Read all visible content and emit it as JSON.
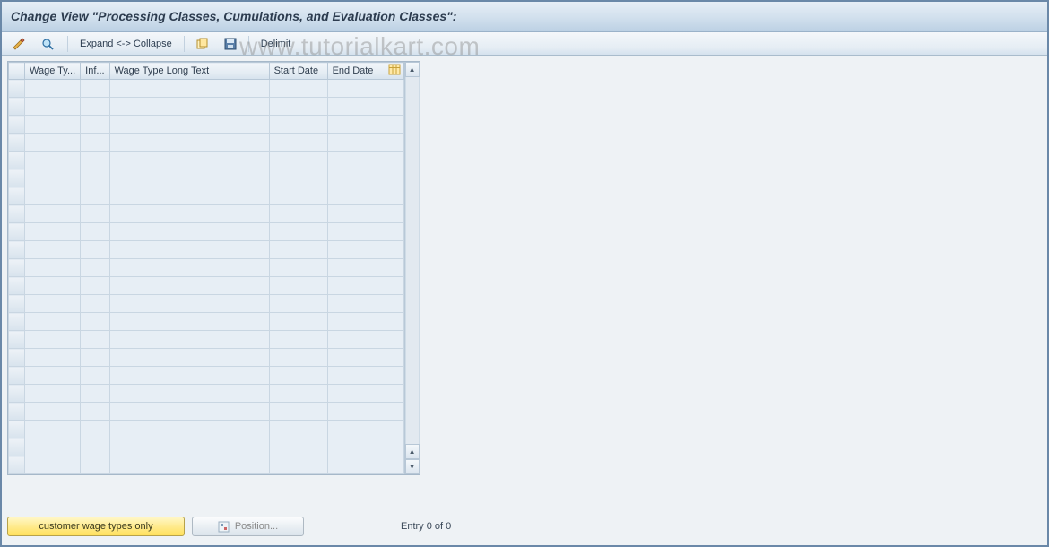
{
  "title": "Change View \"Processing Classes, Cumulations, and Evaluation Classes\":",
  "toolbar": {
    "expand_collapse": "Expand <-> Collapse",
    "delimit": "Delimit"
  },
  "columns": {
    "wage_type": "Wage Ty...",
    "inf": "Inf...",
    "long_text": "Wage Type Long Text",
    "start_date": "Start Date",
    "end_date": "End Date"
  },
  "rows": [
    {},
    {},
    {},
    {},
    {},
    {},
    {},
    {},
    {},
    {},
    {},
    {},
    {},
    {},
    {},
    {},
    {},
    {},
    {},
    {},
    {},
    {}
  ],
  "footer": {
    "customer_btn": "customer wage types only",
    "position_btn": "Position...",
    "status": "Entry 0 of 0"
  },
  "watermark": "www.tutorialkart.com"
}
